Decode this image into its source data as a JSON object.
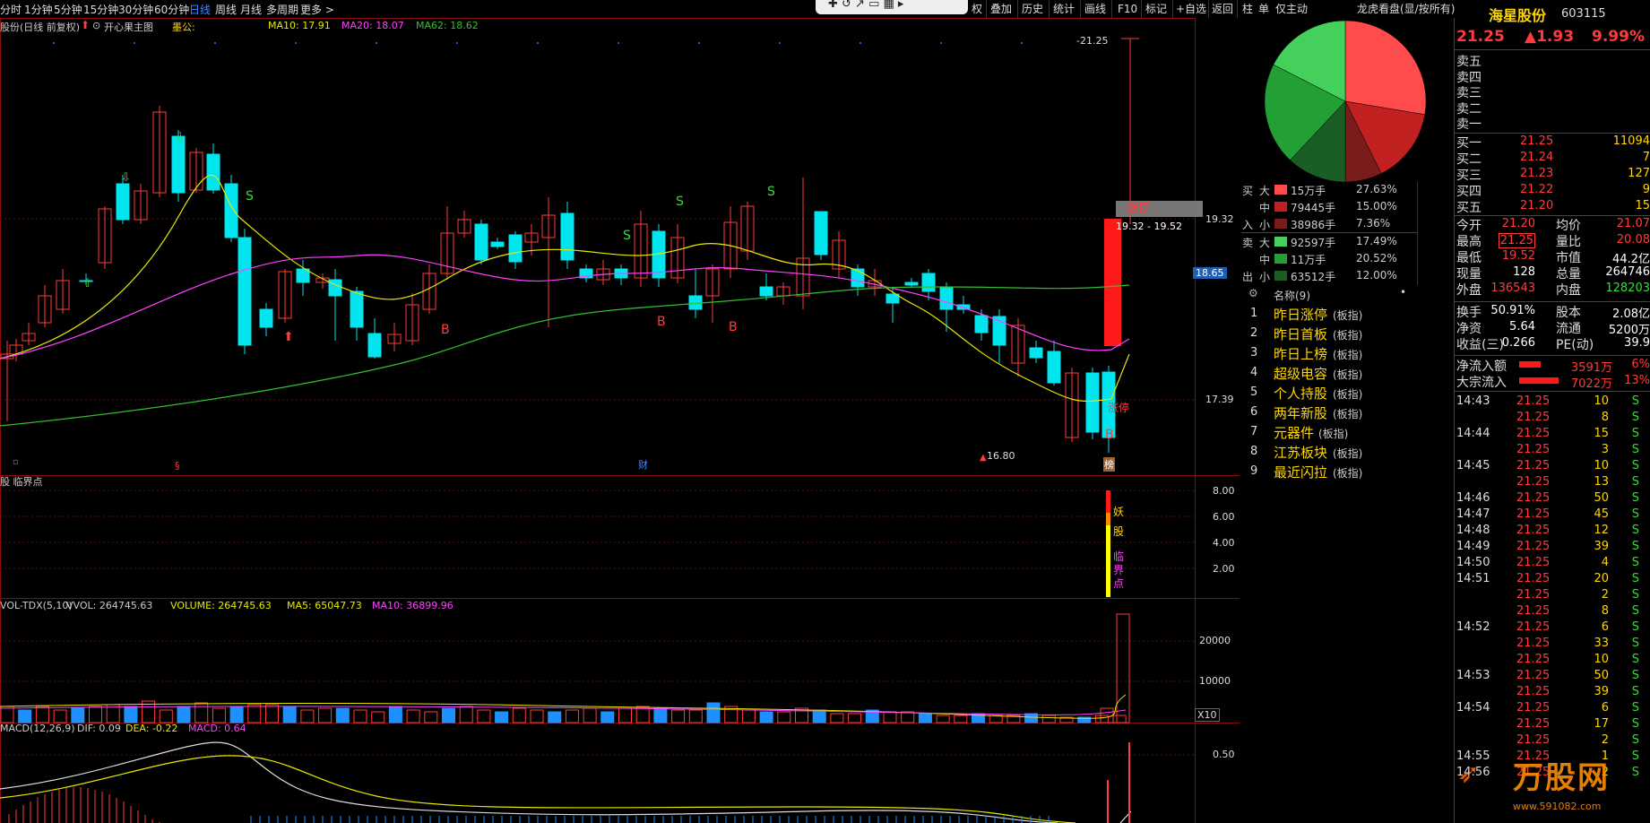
{
  "toolbar": {
    "periods": [
      "分时",
      "1分钟",
      "5分钟",
      "15分钟",
      "30分钟",
      "60分钟",
      "日线",
      "周线",
      "月线",
      "多周期",
      "更多 >"
    ],
    "active_period": "日线",
    "right_items": [
      "权",
      "叠加",
      "历史",
      "统计",
      "画线",
      "F10",
      "标记",
      "+自选",
      "返回"
    ],
    "rightpanel_items": [
      "柱",
      "单",
      "仅主动",
      "龙虎看盘(显/按所有)"
    ]
  },
  "main_chart": {
    "title": "股份(日线 前复权)",
    "indicator_name": "开心果主图",
    "indicator_tag": "墨公:",
    "ma10": "MA10: 17.91",
    "ma20": "MA20: 18.07",
    "ma62": "MA62: 18.62",
    "high_label": "-21.25",
    "low_label": "16.80",
    "price_ticks": [
      "19.32",
      "18.65",
      "17.39"
    ],
    "zhangting_label": "涨停",
    "zhangting_range": "19.32 - 19.52",
    "zhangting_mark": "涨停",
    "b_mark": "B",
    "bottom_marks": [
      "财",
      "榜"
    ]
  },
  "sub_chart": {
    "title": "股 临界点",
    "ticks": [
      "8.00",
      "6.00",
      "4.00",
      "2.00"
    ],
    "vertical_text": [
      "妖",
      "股",
      "临",
      "界",
      "点"
    ]
  },
  "volume_chart": {
    "title": "VOL-TDX(5,10)",
    "vvol": "VVOL: 264745.63",
    "volume": "VOLUME: 264745.63",
    "ma5": "MA5: 65047.73",
    "ma10": "MA10: 36899.96",
    "ticks": [
      "20000",
      "10000"
    ],
    "unit": "X10"
  },
  "macd_chart": {
    "title": "MACD(12,26,9)",
    "dif": "DIF: 0.09",
    "dea": "DEA: -0.22",
    "macd": "MACD: 0.64",
    "tick": "0.50"
  },
  "capital_flow": {
    "buy_rows": [
      {
        "label": "大",
        "amount": "15万手",
        "pct": "27.63%",
        "color": "#ff4b4b"
      },
      {
        "label": "中",
        "amount": "79445手",
        "pct": "15.00%",
        "color": "#c02020"
      },
      {
        "label": "小",
        "amount": "38986手",
        "pct": "7.36%",
        "color": "#7a1c1c"
      }
    ],
    "sell_rows": [
      {
        "label": "大",
        "amount": "92597手",
        "pct": "17.49%",
        "color": "#44d05a"
      },
      {
        "label": "中",
        "amount": "11万手",
        "pct": "20.52%",
        "color": "#22a035"
      },
      {
        "label": "小",
        "amount": "63512手",
        "pct": "12.00%",
        "color": "#1a5e25"
      }
    ],
    "side_buy": [
      "买",
      "入"
    ],
    "side_sell": [
      "卖",
      "出"
    ]
  },
  "sectors": {
    "header": "名称(9)",
    "items": [
      {
        "no": "1",
        "name": "昨日涨停",
        "tag": "(板指)"
      },
      {
        "no": "2",
        "name": "昨日首板",
        "tag": "(板指)"
      },
      {
        "no": "3",
        "name": "昨日上榜",
        "tag": "(板指)"
      },
      {
        "no": "4",
        "name": "超级电容",
        "tag": "(板指)"
      },
      {
        "no": "5",
        "name": "个人持股",
        "tag": "(板指)"
      },
      {
        "no": "6",
        "name": "两年新股",
        "tag": "(板指)"
      },
      {
        "no": "7",
        "name": "元器件",
        "tag": "(板指)"
      },
      {
        "no": "8",
        "name": "江苏板块",
        "tag": "(板指)"
      },
      {
        "no": "9",
        "name": "最近闪拉",
        "tag": "(板指)"
      }
    ]
  },
  "stock": {
    "name": "海星股份",
    "code": "603115",
    "price": "21.25",
    "change": "▲1.93",
    "pct": "9.99%"
  },
  "orderbook": {
    "sell": [
      "卖五",
      "卖四",
      "卖三",
      "卖二",
      "卖一"
    ],
    "buy": [
      {
        "label": "买一",
        "price": "21.25",
        "vol": "11094"
      },
      {
        "label": "买二",
        "price": "21.24",
        "vol": "7"
      },
      {
        "label": "买三",
        "price": "21.23",
        "vol": "127"
      },
      {
        "label": "买四",
        "price": "21.22",
        "vol": "9"
      },
      {
        "label": "买五",
        "price": "21.20",
        "vol": "15"
      }
    ]
  },
  "stats": [
    {
      "l1": "今开",
      "v1": "21.20",
      "l2": "均价",
      "v2": "21.07"
    },
    {
      "l1": "最高",
      "v1": "21.25",
      "l2": "量比",
      "v2": "20.08"
    },
    {
      "l1": "最低",
      "v1": "19.52",
      "l2": "市值",
      "v2": "44.2亿"
    },
    {
      "l1": "现量",
      "v1": "128",
      "l2": "总量",
      "v2": "264746"
    },
    {
      "l1": "外盘",
      "v1": "136543",
      "l2": "内盘",
      "v2": "128203"
    }
  ],
  "stats2": [
    {
      "l1": "换手",
      "v1": "50.91%",
      "l2": "股本",
      "v2": "2.08亿"
    },
    {
      "l1": "净资",
      "v1": "5.64",
      "l2": "流通",
      "v2": "5200万"
    },
    {
      "l1": "收益(三)",
      "v1": "0.266",
      "l2": "PE(动)",
      "v2": "39.9"
    }
  ],
  "flows": [
    {
      "label": "净流入额",
      "value": "3591万",
      "pct": "6%"
    },
    {
      "label": "大宗流入",
      "value": "7022万",
      "pct": "13%"
    }
  ],
  "ticks": [
    {
      "time": "14:43",
      "price": "21.25",
      "vol": "10",
      "side": "S"
    },
    {
      "time": "",
      "price": "21.25",
      "vol": "8",
      "side": "S"
    },
    {
      "time": "14:44",
      "price": "21.25",
      "vol": "15",
      "side": "S"
    },
    {
      "time": "",
      "price": "21.25",
      "vol": "3",
      "side": "S"
    },
    {
      "time": "14:45",
      "price": "21.25",
      "vol": "10",
      "side": "S"
    },
    {
      "time": "",
      "price": "21.25",
      "vol": "13",
      "side": "S"
    },
    {
      "time": "14:46",
      "price": "21.25",
      "vol": "50",
      "side": "S"
    },
    {
      "time": "14:47",
      "price": "21.25",
      "vol": "45",
      "side": "S"
    },
    {
      "time": "14:48",
      "price": "21.25",
      "vol": "12",
      "side": "S"
    },
    {
      "time": "14:49",
      "price": "21.25",
      "vol": "39",
      "side": "S"
    },
    {
      "time": "14:50",
      "price": "21.25",
      "vol": "4",
      "side": "S"
    },
    {
      "time": "14:51",
      "price": "21.25",
      "vol": "20",
      "side": "S"
    },
    {
      "time": "",
      "price": "21.25",
      "vol": "2",
      "side": "S"
    },
    {
      "time": "",
      "price": "21.25",
      "vol": "8",
      "side": "S"
    },
    {
      "time": "14:52",
      "price": "21.25",
      "vol": "6",
      "side": "S"
    },
    {
      "time": "",
      "price": "21.25",
      "vol": "33",
      "side": "S"
    },
    {
      "time": "",
      "price": "21.25",
      "vol": "10",
      "side": "S"
    },
    {
      "time": "14:53",
      "price": "21.25",
      "vol": "50",
      "side": "S"
    },
    {
      "time": "",
      "price": "21.25",
      "vol": "39",
      "side": "S"
    },
    {
      "time": "14:54",
      "price": "21.25",
      "vol": "6",
      "side": "S"
    },
    {
      "time": "",
      "price": "21.25",
      "vol": "17",
      "side": "S"
    },
    {
      "time": "",
      "price": "21.25",
      "vol": "2",
      "side": "S"
    },
    {
      "time": "14:55",
      "price": "21.25",
      "vol": "1",
      "side": "S"
    },
    {
      "time": "14:56",
      "price": "21.25",
      "vol": "2",
      "side": "S"
    }
  ],
  "watermark": {
    "text": "万股网",
    "url": "www.591082.com"
  },
  "colors": {
    "up": "#ff3b3b",
    "down": "#00e5ee",
    "ma10": "#e8e800",
    "ma20": "#ff40ff",
    "ma62": "#30c030",
    "bg": "#000000"
  }
}
